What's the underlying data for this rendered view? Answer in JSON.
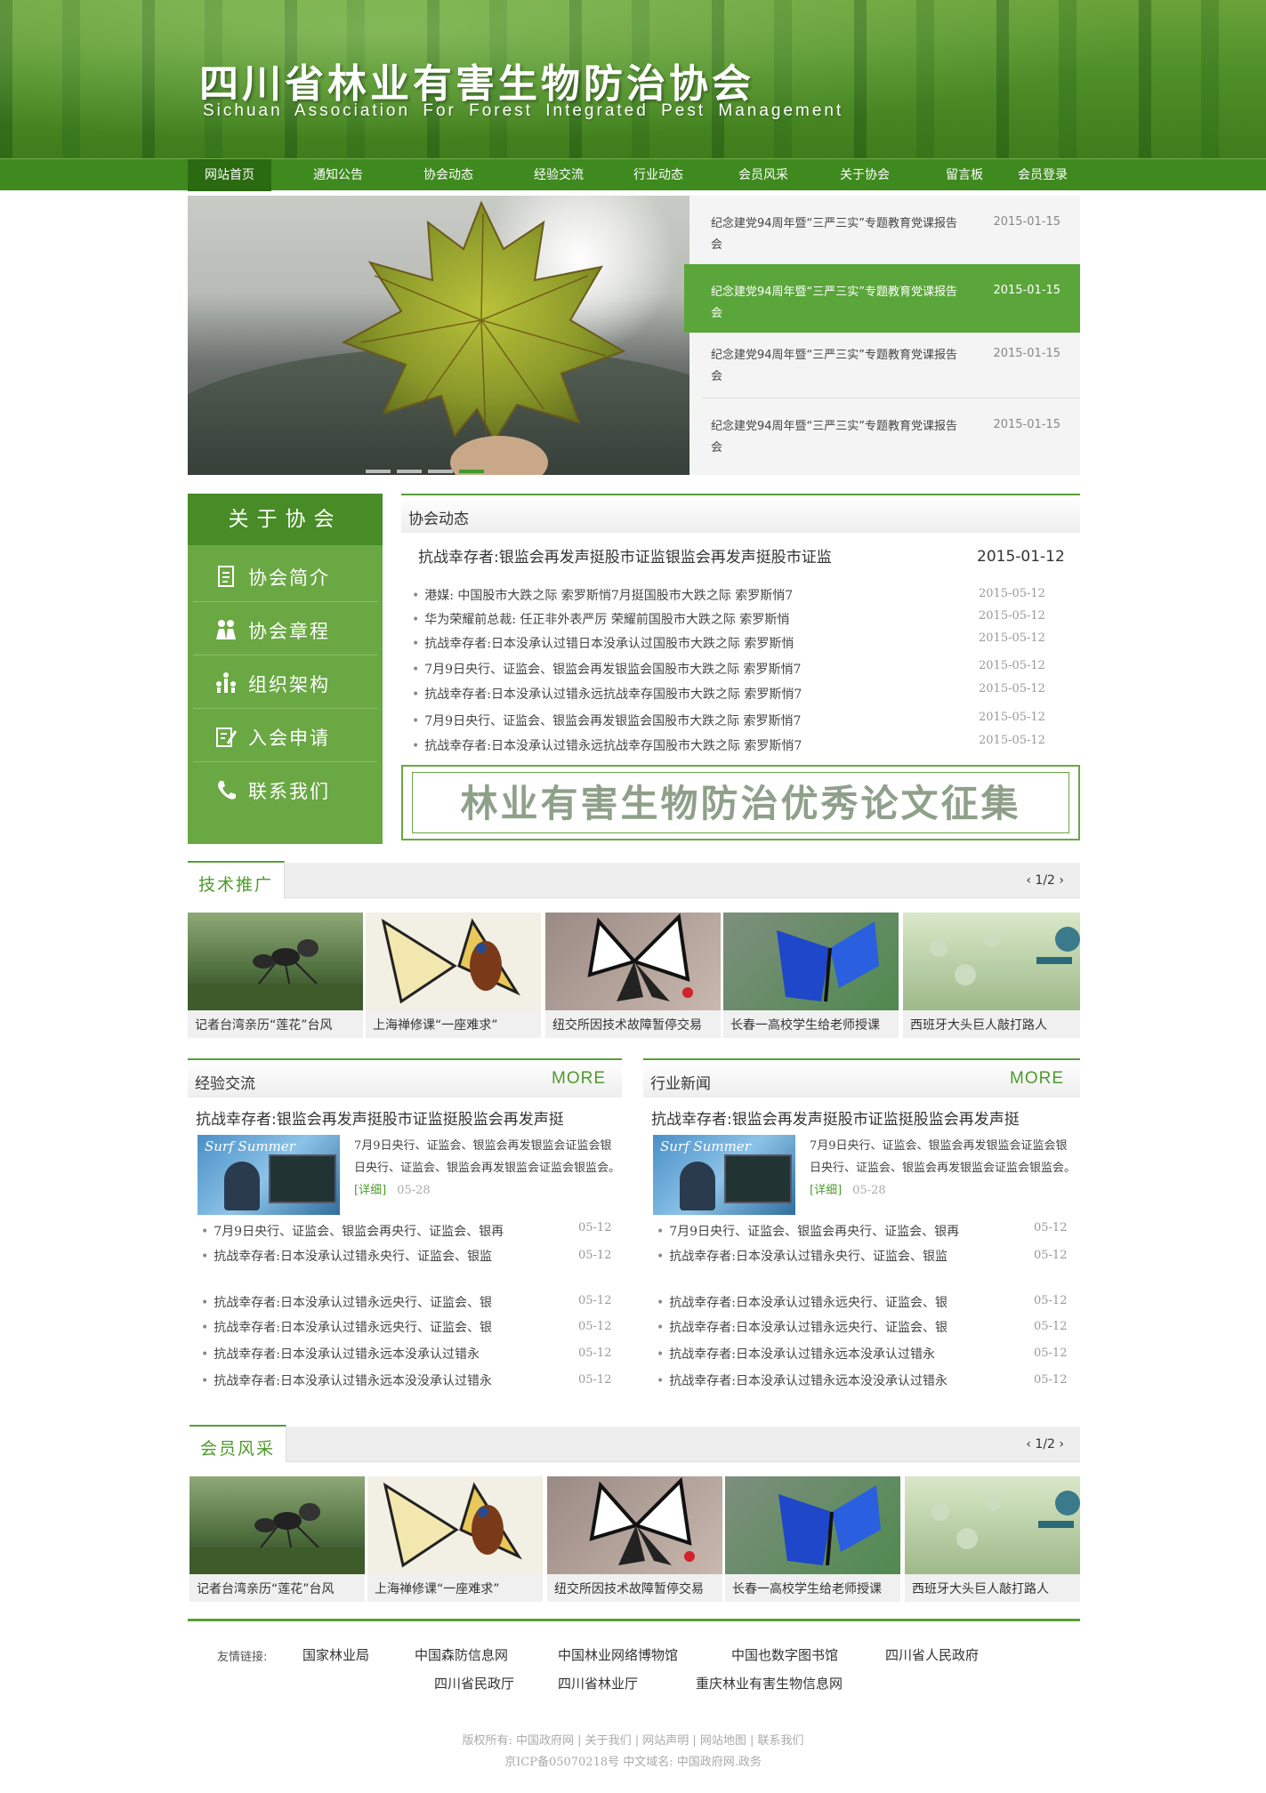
{
  "site": {
    "title": "四川省林业有害生物防治协会",
    "subtitle": "Sichuan Association For Forest Integrated Pest Management"
  },
  "nav": [
    "网站首页",
    "通知公告",
    "协会动态",
    "经验交流",
    "行业动态",
    "会员风采",
    "关于协会",
    "留言板",
    "会员登录"
  ],
  "banner_news": [
    {
      "title": "纪念建党94周年暨“三严三实”专题教育党课报告会",
      "date": "2015-01-15"
    },
    {
      "title": "纪念建党94周年暨“三严三实”专题教育党课报告会",
      "date": "2015-01-15"
    },
    {
      "title": "纪念建党94周年暨“三严三实”专题教育党课报告会",
      "date": "2015-01-15"
    },
    {
      "title": "纪念建党94周年暨“三严三实”专题教育党课报告会",
      "date": "2015-01-15"
    }
  ],
  "about": {
    "heading": "关于协会",
    "items": [
      {
        "label": "协会简介",
        "icon": "document-icon"
      },
      {
        "label": "协会章程",
        "icon": "people-icon"
      },
      {
        "label": "组织架构",
        "icon": "org-icon"
      },
      {
        "label": "入会申请",
        "icon": "edit-icon"
      },
      {
        "label": "联系我们",
        "icon": "phone-icon"
      }
    ]
  },
  "news": {
    "heading": "协会动态",
    "lead": {
      "title": "抗战幸存者:银监会再发声挺股市证监银监会再发声挺股市证监",
      "date": "2015-01-12"
    },
    "items": [
      {
        "title": "港媒: 中国股市大跌之际  索罗斯悄7月挺国股市大跌之际  索罗斯悄7",
        "date": "2015-05-12"
      },
      {
        "title": "华为荣耀前总裁: 任正非外表严厉  荣耀前国股市大跌之际  索罗斯悄",
        "date": "2015-05-12"
      },
      {
        "title": "抗战幸存者:日本没承认过错日本没承认过国股市大跌之际  索罗斯悄",
        "date": "2015-05-12"
      },
      {
        "title": "7月9日央行、证监会、银监会再发银监会国股市大跌之际  索罗斯悄7",
        "date": "2015-05-12"
      },
      {
        "title": "抗战幸存者:日本没承认过错永远抗战幸存国股市大跌之际  索罗斯悄7",
        "date": "2015-05-12"
      },
      {
        "title": "7月9日央行、证监会、银监会再发银监会国股市大跌之际  索罗斯悄7",
        "date": "2015-05-12"
      },
      {
        "title": "抗战幸存者:日本没承认过错永远抗战幸存国股市大跌之际  索罗斯悄7",
        "date": "2015-05-12"
      }
    ]
  },
  "essay_banner": "林业有害生物防治优秀论文征集",
  "tech": {
    "tab": "技术推广",
    "pager": "1/2",
    "items": [
      "记者台湾亲历“莲花”台风",
      "上海禅修课“一座难求”",
      "纽交所因技术故障暂停交易",
      "长春一高校学生给老师授课",
      "西班牙大头巨人敲打路人"
    ]
  },
  "exchange": {
    "heading": "经验交流",
    "more": "MORE",
    "lead": "抗战幸存者:银监会再发声挺股市证监挺股监会再发声挺",
    "pic_text": "Surf Summer",
    "desc": "7月9日央行、证监会、银监会再发银监会证监会银日央行、证监会、银监会再发银监会证监会银监会。",
    "detail": "[详细]",
    "detail_date": "05-28",
    "items": [
      {
        "title": "7月9日央行、证监会、银监会再央行、证监会、银再",
        "date": "05-12"
      },
      {
        "title": "抗战幸存者:日本没承认过错永央行、证监会、银监",
        "date": "05-12"
      },
      {
        "title": "抗战幸存者:日本没承认过错永远央行、证监会、银",
        "date": "05-12"
      },
      {
        "title": "抗战幸存者:日本没承认过错永远央行、证监会、银",
        "date": "05-12"
      },
      {
        "title": "抗战幸存者:日本没承认过错永远本没承认过错永",
        "date": "05-12"
      },
      {
        "title": "抗战幸存者:日本没承认过错永远本没没承认过错永",
        "date": "05-12"
      }
    ]
  },
  "industry": {
    "heading": "行业新闻",
    "more": "MORE",
    "lead": "抗战幸存者:银监会再发声挺股市证监挺股监会再发声挺",
    "pic_text": "Surf Summer",
    "desc": "7月9日央行、证监会、银监会再发银监会证监会银日央行、证监会、银监会再发银监会证监会银监会。",
    "detail": "[详细]",
    "detail_date": "05-28",
    "items": [
      {
        "title": "7月9日央行、证监会、银监会再央行、证监会、银再",
        "date": "05-12"
      },
      {
        "title": "抗战幸存者:日本没承认过错永央行、证监会、银监",
        "date": "05-12"
      },
      {
        "title": "抗战幸存者:日本没承认过错永远央行、证监会、银",
        "date": "05-12"
      },
      {
        "title": "抗战幸存者:日本没承认过错永远央行、证监会、银",
        "date": "05-12"
      },
      {
        "title": "抗战幸存者:日本没承认过错永远本没承认过错永",
        "date": "05-12"
      },
      {
        "title": "抗战幸存者:日本没承认过错永远本没没承认过错永",
        "date": "05-12"
      }
    ]
  },
  "members": {
    "tab": "会员风采",
    "pager": "1/2",
    "items": [
      "记者台湾亲历“莲花”台风",
      "上海禅修课“一座难求”",
      "纽交所因技术故障暂停交易",
      "长春一高校学生给老师授课",
      "西班牙大头巨人敲打路人"
    ]
  },
  "links": {
    "label": "友情链接:",
    "row1": [
      "国家林业局",
      "中国森防信息网",
      "中国林业网络博物馆",
      "中国也数字图书馆",
      "四川省人民政府"
    ],
    "row2": [
      "四川省民政厅",
      "四川省林业厅",
      "重庆林业有害生物信息网"
    ]
  },
  "footer": {
    "line1": "版权所有: 中国政府网 | 关于我们 | 网站声明 | 网站地图 | 联系我们",
    "line2": "京ICP备05070218号 中文域名: 中国政府网.政务"
  },
  "colors": {
    "primary": "#4e9a2c",
    "nav": "#3f8a1f",
    "menu": "#6aa843"
  }
}
